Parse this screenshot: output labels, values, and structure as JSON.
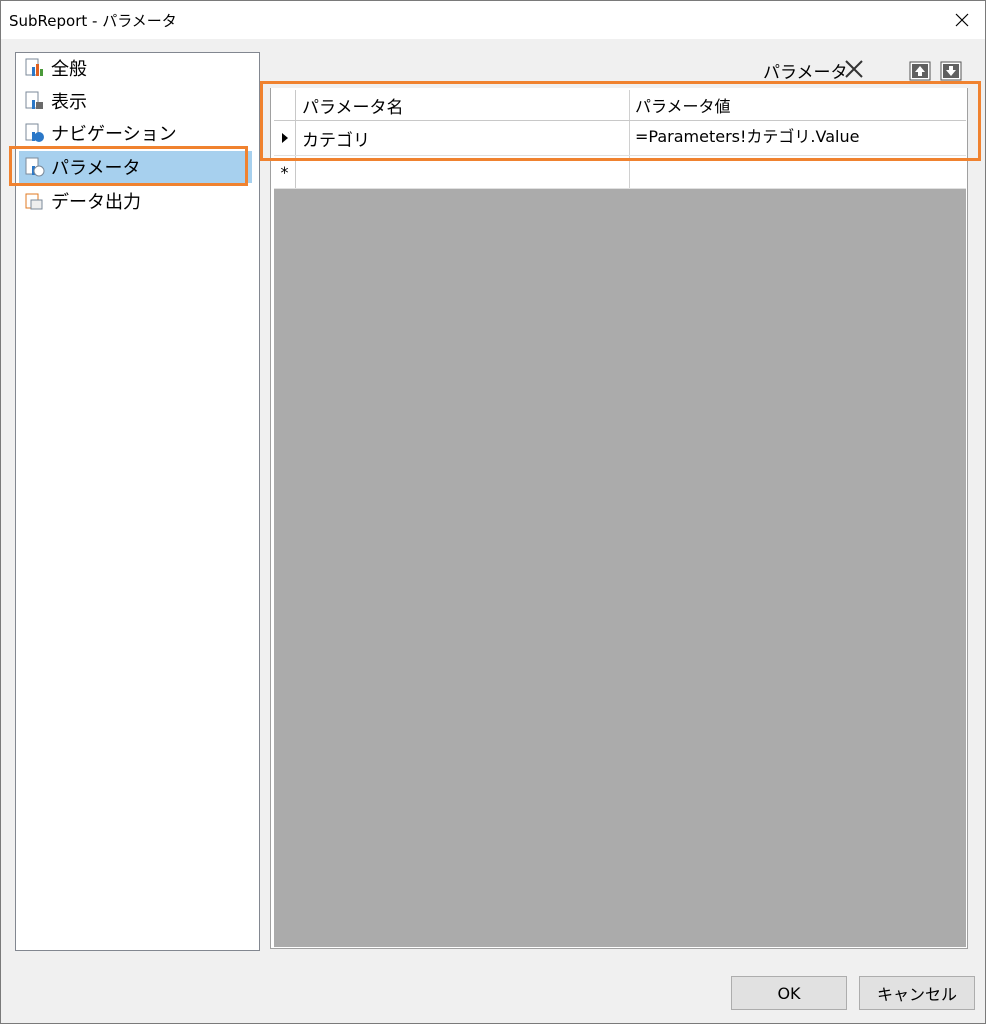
{
  "window": {
    "title": "SubReport - パラメータ"
  },
  "nav": {
    "items": [
      {
        "label": "全般",
        "icon": "report-general-icon"
      },
      {
        "label": "表示",
        "icon": "report-display-icon"
      },
      {
        "label": "ナビゲーション",
        "icon": "report-navigation-icon"
      },
      {
        "label": "パラメータ",
        "icon": "report-parameter-icon",
        "selected": true
      },
      {
        "label": "データ出力",
        "icon": "data-output-icon"
      }
    ]
  },
  "toolbar": {
    "label": "パラメータ"
  },
  "grid": {
    "columns": [
      "パラメータ名",
      "パラメータ値"
    ],
    "rows": [
      {
        "name": "カテゴリ",
        "value": "=Parameters!カテゴリ.Value"
      }
    ],
    "new_row_marker": "*"
  },
  "buttons": {
    "ok": "OK",
    "cancel": "キャンセル"
  },
  "colors": {
    "highlight": "#f0822f",
    "selection": "#a7d0ee",
    "grid_empty": "#ababab"
  }
}
